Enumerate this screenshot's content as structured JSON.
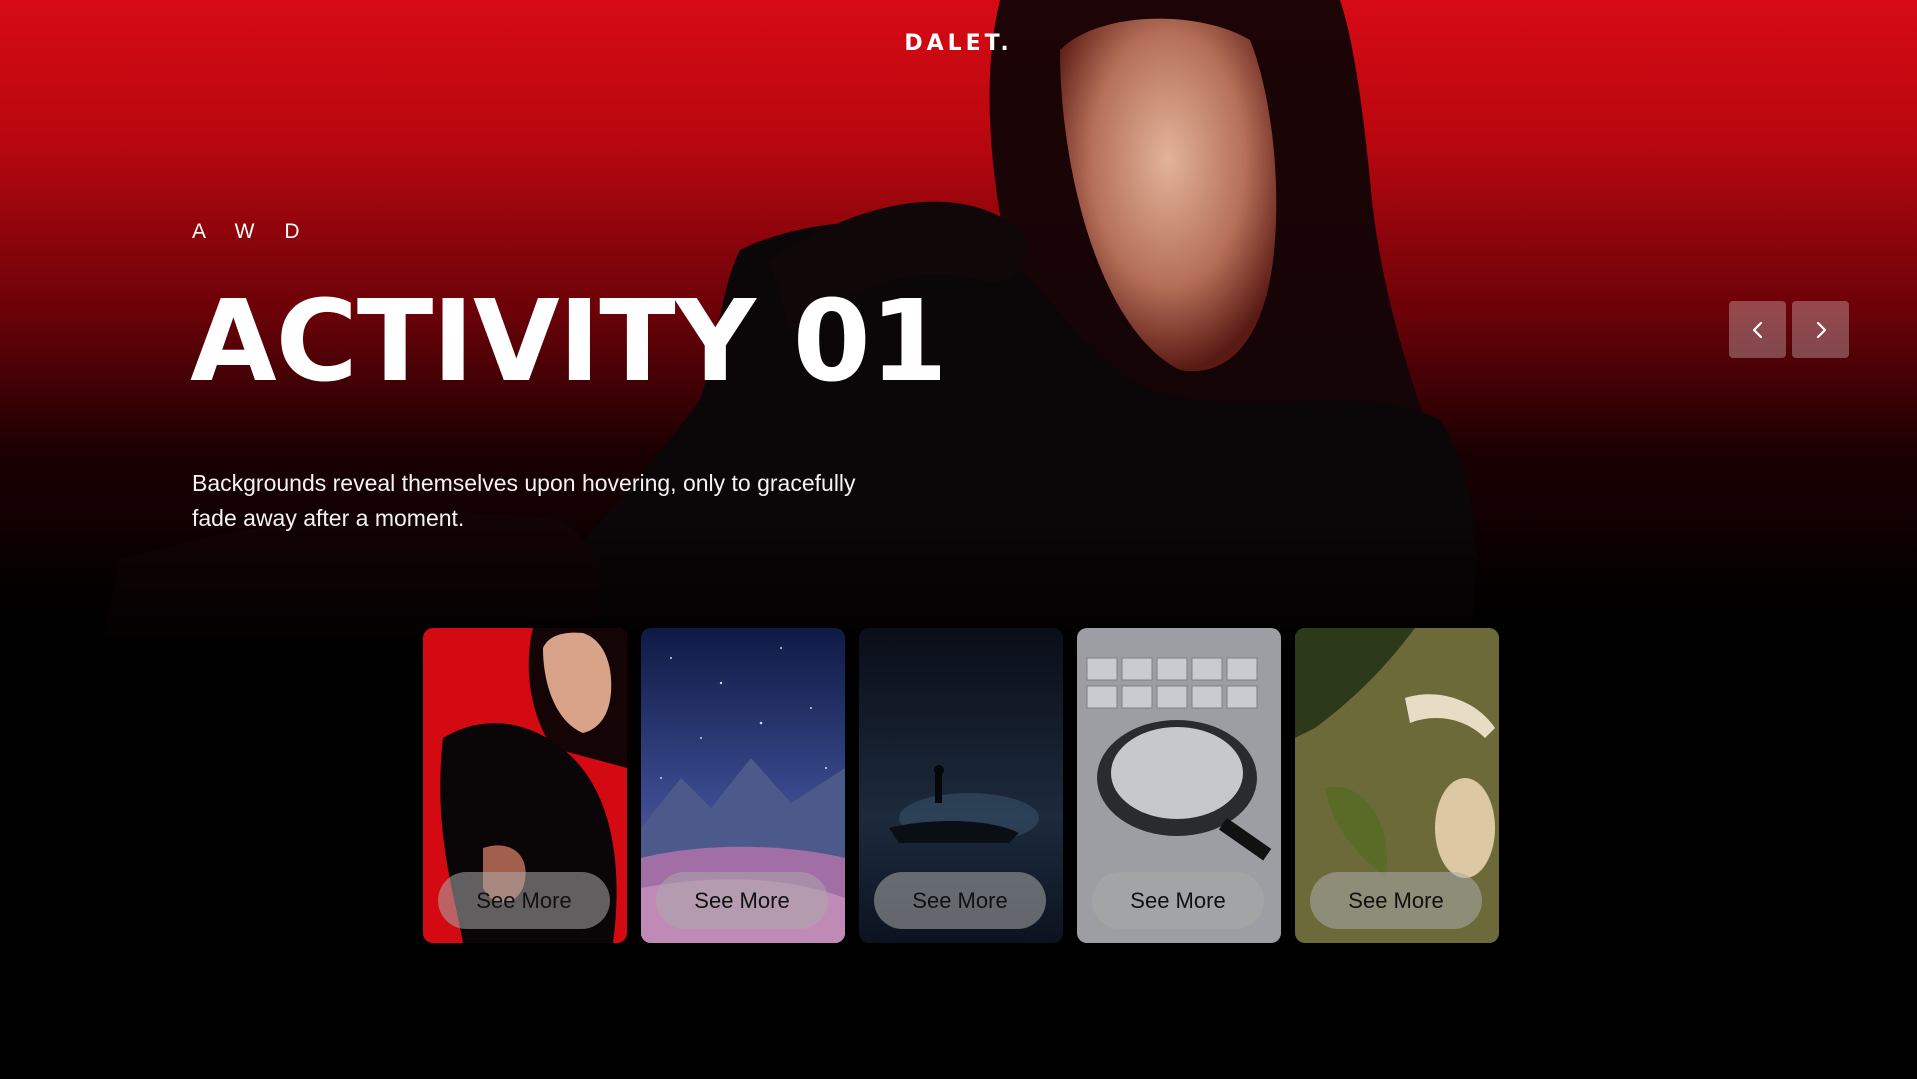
{
  "brand": {
    "logo": "DALET."
  },
  "hero": {
    "kicker": "A W D",
    "title": "ACTIVITY 01",
    "description": "Backgrounds reveal themselves upon hovering, only to gracefully fade away after a moment."
  },
  "nav": {
    "prev_icon": "chevron-left-icon",
    "next_icon": "chevron-right-icon"
  },
  "cards": [
    {
      "label": "See More",
      "theme": "portrait-red"
    },
    {
      "label": "See More",
      "theme": "starry-mountains"
    },
    {
      "label": "See More",
      "theme": "night-silhouette"
    },
    {
      "label": "See More",
      "theme": "magnifier-keyboard"
    },
    {
      "label": "See More",
      "theme": "pine-bell"
    }
  ],
  "colors": {
    "accent": "#d70a14",
    "background": "#000000"
  }
}
